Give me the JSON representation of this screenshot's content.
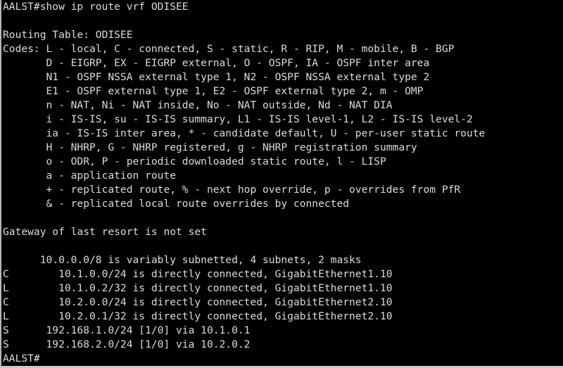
{
  "terminal": {
    "title": "AALST terminal session",
    "background_color": "#000000",
    "foreground_color": "#dcdcdc",
    "border_color": "#b8b8b8",
    "prompt": "AALST#",
    "command": "show ip route vrf ODISEE",
    "font_columns": 80,
    "lines": [
      "AALST#show ip route vrf ODISEE",
      "",
      "Routing Table: ODISEE",
      "Codes: L - local, C - connected, S - static, R - RIP, M - mobile, B - BGP",
      "       D - EIGRP, EX - EIGRP external, O - OSPF, IA - OSPF inter area",
      "       N1 - OSPF NSSA external type 1, N2 - OSPF NSSA external type 2",
      "       E1 - OSPF external type 1, E2 - OSPF external type 2, m - OMP",
      "       n - NAT, Ni - NAT inside, No - NAT outside, Nd - NAT DIA",
      "       i - IS-IS, su - IS-IS summary, L1 - IS-IS level-1, L2 - IS-IS level-2",
      "       ia - IS-IS inter area, * - candidate default, U - per-user static route",
      "       H - NHRP, G - NHRP registered, g - NHRP registration summary",
      "       o - ODR, P - periodic downloaded static route, l - LISP",
      "       a - application route",
      "       + - replicated route, % - next hop override, p - overrides from PfR",
      "       & - replicated local route overrides by connected",
      "",
      "Gateway of last resort is not set",
      "",
      "      10.0.0.0/8 is variably subnetted, 4 subnets, 2 masks",
      "C        10.1.0.0/24 is directly connected, GigabitEthernet1.10",
      "L        10.1.0.2/32 is directly connected, GigabitEthernet1.10",
      "C        10.2.0.0/24 is directly connected, GigabitEthernet2.10",
      "L        10.2.0.1/32 is directly connected, GigabitEthernet2.10",
      "S      192.168.1.0/24 [1/0] via 10.1.0.1",
      "S      192.168.2.0/24 [1/0] via 10.2.0.2",
      "AALST#"
    ],
    "sections": {
      "command_line": "AALST#show ip route vrf ODISEE",
      "routing_table_header": "Routing Table: ODISEE",
      "codes_legend_title": "Codes:",
      "codes": [
        "L - local",
        "C - connected",
        "S - static",
        "R - RIP",
        "M - mobile",
        "B - BGP",
        "D - EIGRP",
        "EX - EIGRP external",
        "O - OSPF",
        "IA - OSPF inter area",
        "N1 - OSPF NSSA external type 1",
        "N2 - OSPF NSSA external type 2",
        "E1 - OSPF external type 1",
        "E2 - OSPF external type 2",
        "m - OMP",
        "n - NAT",
        "Ni - NAT inside",
        "No - NAT outside",
        "Nd - NAT DIA",
        "i - IS-IS",
        "su - IS-IS summary",
        "L1 - IS-IS level-1",
        "L2 - IS-IS level-2",
        "ia - IS-IS inter area",
        "* - candidate default",
        "U - per-user static route",
        "H - NHRP",
        "G - NHRP registered",
        "g - NHRP registration summary",
        "o - ODR",
        "P - periodic downloaded static route",
        "l - LISP",
        "a - application route",
        "+ - replicated route",
        "% - next hop override",
        "p - overrides from PfR",
        "& - replicated local route overrides by connected"
      ],
      "gateway_line": "Gateway of last resort is not set",
      "subnet_summary": "10.0.0.0/8 is variably subnetted, 4 subnets, 2 masks",
      "routes": [
        {
          "code": "C",
          "network": "10.1.0.0/24",
          "detail": "is directly connected, GigabitEthernet1.10"
        },
        {
          "code": "L",
          "network": "10.1.0.2/32",
          "detail": "is directly connected, GigabitEthernet1.10"
        },
        {
          "code": "C",
          "network": "10.2.0.0/24",
          "detail": "is directly connected, GigabitEthernet2.10"
        },
        {
          "code": "L",
          "network": "10.2.0.1/32",
          "detail": "is directly connected, GigabitEthernet2.10"
        },
        {
          "code": "S",
          "network": "192.168.1.0/24",
          "detail": "[1/0] via 10.1.0.1"
        },
        {
          "code": "S",
          "network": "192.168.2.0/24",
          "detail": "[1/0] via 10.2.0.2"
        }
      ],
      "final_prompt": "AALST#"
    },
    "line_text": {
      "l0": "AALST#show ip route vrf ODISEE",
      "l1": "",
      "l2": "Routing Table: ODISEE",
      "l3": "Codes: L - local, C - connected, S - static, R - RIP, M - mobile, B - BGP",
      "l4": "       D - EIGRP, EX - EIGRP external, O - OSPF, IA - OSPF inter area",
      "l5": "       N1 - OSPF NSSA external type 1, N2 - OSPF NSSA external type 2",
      "l6": "       E1 - OSPF external type 1, E2 - OSPF external type 2, m - OMP",
      "l7": "       n - NAT, Ni - NAT inside, No - NAT outside, Nd - NAT DIA",
      "l8": "       i - IS-IS, su - IS-IS summary, L1 - IS-IS level-1, L2 - IS-IS level-2",
      "l9": "       ia - IS-IS inter area, * - candidate default, U - per-user static route",
      "l10": "       H - NHRP, G - NHRP registered, g - NHRP registration summary",
      "l11": "       o - ODR, P - periodic downloaded static route, l - LISP",
      "l12": "       a - application route",
      "l13": "       + - replicated route, % - next hop override, p - overrides from PfR",
      "l14": "       & - replicated local route overrides by connected",
      "l15": "",
      "l16": "Gateway of last resort is not set",
      "l17": "",
      "l18": "      10.0.0.0/8 is variably subnetted, 4 subnets, 2 masks",
      "l19": "C        10.1.0.0/24 is directly connected, GigabitEthernet1.10",
      "l20": "L        10.1.0.2/32 is directly connected, GigabitEthernet1.10",
      "l21": "C        10.2.0.0/24 is directly connected, GigabitEthernet2.10",
      "l22": "L        10.2.0.1/32 is directly connected, GigabitEthernet2.10",
      "l23": "S      192.168.1.0/24 [1/0] via 10.1.0.1",
      "l24": "S      192.168.2.0/24 [1/0] via 10.2.0.2",
      "l25": "AALST#"
    }
  }
}
